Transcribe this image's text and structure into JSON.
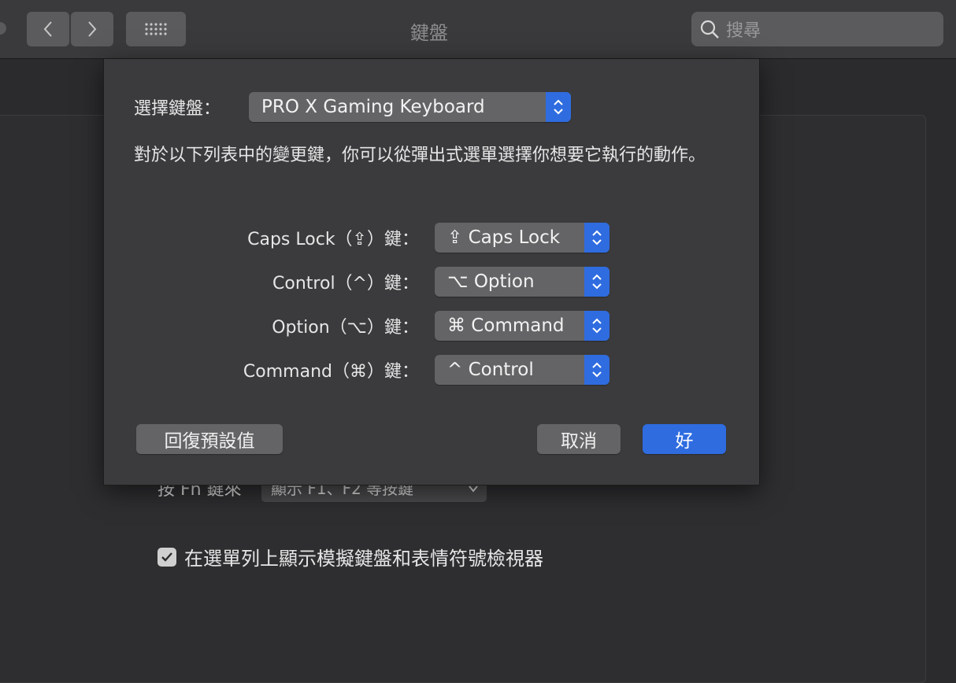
{
  "toolbar": {
    "title": "鍵盤",
    "search_placeholder": "搜尋"
  },
  "background": {
    "fn_label": "按 Fn 鍵來",
    "fn_value": "顯示 F1、F2 等按鍵",
    "checkbox_label": "在選單列上顯示模擬鍵盤和表情符號檢視器",
    "checkbox_checked": true
  },
  "sheet": {
    "keyboard_label": "選擇鍵盤：",
    "keyboard_value": "PRO X Gaming Keyboard",
    "description": "對於以下列表中的變更鍵，你可以從彈出式選單選擇你想要它執行的動作。",
    "modifiers": [
      {
        "label": "Caps Lock（⇪）鍵：",
        "value": "⇪ Caps Lock"
      },
      {
        "label": "Control（^）鍵：",
        "value": "⌥ Option"
      },
      {
        "label": "Option（⌥）鍵：",
        "value": "⌘ Command"
      },
      {
        "label": "Command（⌘）鍵：",
        "value": "^ Control"
      }
    ],
    "restore_label": "回復預設值",
    "cancel_label": "取消",
    "ok_label": "好"
  },
  "colors": {
    "accent": "#2f6ce0",
    "sheet_bg": "#3b3b3d",
    "window_bg": "#2b2b2d"
  }
}
